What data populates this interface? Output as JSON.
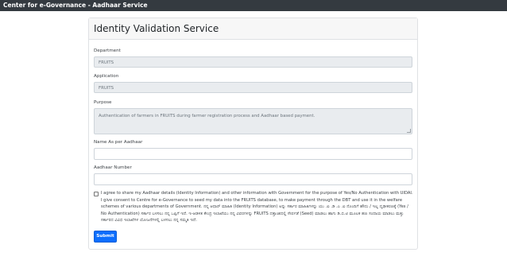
{
  "topbar": {
    "title": "Center for e-Governance - Aadhaar Service"
  },
  "card": {
    "title": "Identity Validation Service"
  },
  "form": {
    "department": {
      "label": "Department",
      "value": "FRUITS"
    },
    "application": {
      "label": "Application",
      "value": "FRUITS"
    },
    "purpose": {
      "label": "Purpose",
      "value": "Authentication of farmers in FRUITS during farmer registration process and Aadhaar based payment."
    },
    "name": {
      "label": "Name As per Aadhaar",
      "value": ""
    },
    "aadhaar": {
      "label": "Aadhaar Number",
      "value": ""
    },
    "consent": {
      "checked": false,
      "text_en": "I agree to share my Aadhaar details (Identity Information) and other information with Government for the purpose of Yes/No Authentication with UIDAI. I give consent to Centre for e-Governance to seed my data into the FRUITS database, to make payment through the DBT and use it in the welfare schemes of various departments of Government.",
      "text_kn": "ನನ್ನ ಆಧಾರ್ ಮಾಹಿತಿ (Identity Information) ಅನ್ನು ಸರ್ಕಾರ ಮಾಹಿತಿಗಳನ್ನು ಯು .ಐ .ಡಿ .ಎ .ಐ ನೊಂದಿಗೆ ಹೌದು / ಇಲ್ಲ ದೃಢೀಕರಣಕ್ಕೆ (Yes / No Authentication) ಸರ್ಕಾರ ಬಳಸಲು ನನ್ನ ಒಪ್ಪಿಗೆ ಇದೆ. ಇ-ಆಡಳಿತ ಕೇಂದ್ರ ಇಲಾಖೆಯು ನನ್ನ ವಿವರಗಳನ್ನು FRUITS ದತ್ತಾಂಶದಲ್ಲಿ ಸೇರ್ಪಡೆ (Seed) ಮಾಡಲು ಹಾಗು ಡಿ.ಬಿ.ಟಿ ಮೂಲಕ ಹಣ ಸಂದಾಯ ಮಾಡಲು ಮತ್ತು ಸರ್ಕಾರದ ವಿವಿಧ ಇಲಾಖೆಗಳ ಯೋಜನೆಗಳಲ್ಲಿ ಬಳಸಲು ನನ್ನ ಸಮ್ಮತಿ ಇದೆ."
    },
    "submit_label": "Submit"
  },
  "colors": {
    "topbar": "#343a40",
    "primary": "#0d6efd",
    "readonly_bg": "#e9ecef"
  }
}
